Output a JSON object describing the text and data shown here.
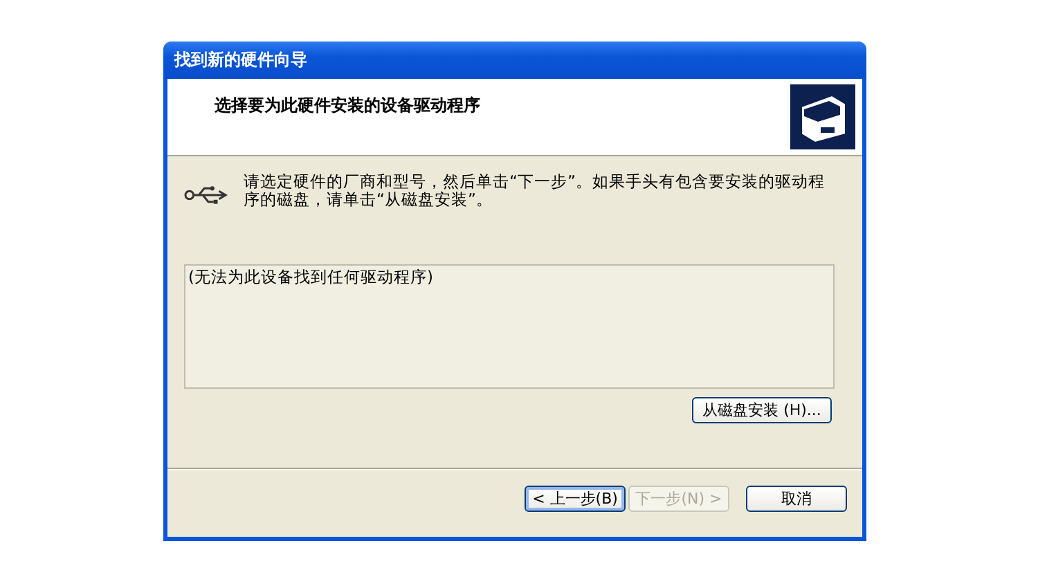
{
  "window": {
    "title": "找到新的硬件向导"
  },
  "header": {
    "title": "选择要为此硬件安装的设备驱动程序"
  },
  "instructions": "请选定硬件的厂商和型号，然后单击“下一步”。如果手头有包含要安装的驱动程序的磁盘，请单击“从磁盘安装”。",
  "driver_list": {
    "items": [
      "(无法为此设备找到任何驱动程序)"
    ]
  },
  "disk_button": {
    "label": "从磁盘安装 (H)..."
  },
  "buttons": [
    {
      "label": "< 上一步(B)",
      "disabled": false,
      "selected": true
    },
    {
      "label": "下一步(N) >",
      "disabled": true,
      "selected": false
    },
    {
      "label": "取消",
      "disabled": false,
      "selected": false
    }
  ]
}
